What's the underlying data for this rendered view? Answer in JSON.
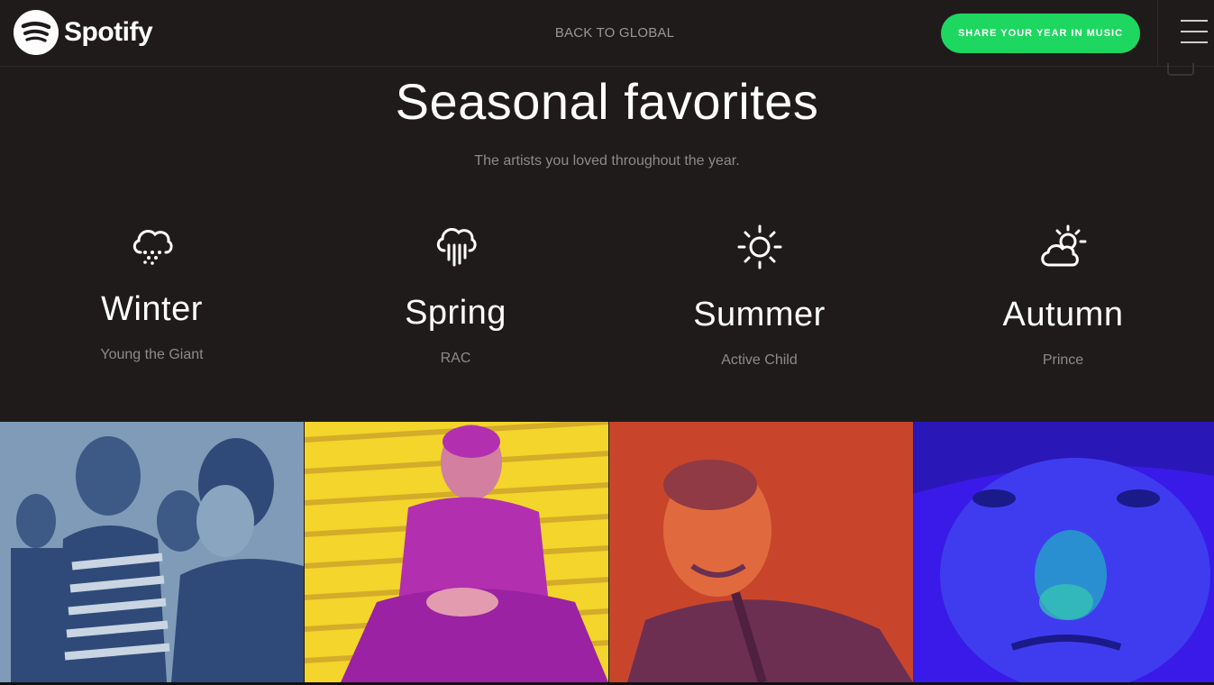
{
  "header": {
    "logo_text": "Spotify",
    "back_label": "BACK TO GLOBAL",
    "share_label": "SHARE YOUR YEAR IN MUSIC",
    "menu_icon": "hamburger-icon"
  },
  "main": {
    "title": "Seasonal favorites",
    "subtitle": "The artists you loved throughout the year."
  },
  "seasons": [
    {
      "name": "Winter",
      "artist": "Young the Giant",
      "icon": "snow-cloud-icon",
      "photo_colors": [
        "#7f9bb8",
        "#2f4a78"
      ]
    },
    {
      "name": "Spring",
      "artist": "RAC",
      "icon": "rain-cloud-icon",
      "photo_colors": [
        "#f3d52b",
        "#b22fb0"
      ]
    },
    {
      "name": "Summer",
      "artist": "Active Child",
      "icon": "sun-icon",
      "photo_colors": [
        "#c8452c",
        "#6c2f52"
      ]
    },
    {
      "name": "Autumn",
      "artist": "Prince",
      "icon": "partly-cloudy-icon",
      "photo_colors": [
        "#3a1ae8",
        "#2a8fd0"
      ]
    }
  ],
  "colors": {
    "background": "#1f1b1b",
    "accent_green": "#1ed760",
    "muted_text": "#8e8a8a"
  }
}
